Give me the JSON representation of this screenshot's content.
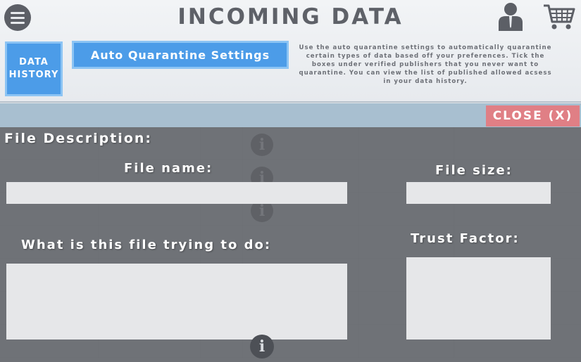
{
  "header": {
    "title": "INCOMING DATA",
    "menu_icon": "hamburger-menu-icon",
    "user_icon": "user-icon",
    "cart_icon": "shopping-cart-icon"
  },
  "toolbar": {
    "history_label": "DATA HISTORY",
    "quarantine_label": "Auto Quarantine Settings",
    "info_text": "Use the auto quarantine settings to automatically quarantine certain types of data based off your preferences. Tick the boxes under verified publishers that you never want to quarantine. You can view the list of published allowed acsess in your data history."
  },
  "modal": {
    "close_label": "CLOSE (X)",
    "description_label": "File Description:",
    "file_name_label": "File name:",
    "file_name_value": "",
    "file_size_label": "File size:",
    "file_size_value": "",
    "purpose_label": "What is this file trying to do:",
    "purpose_value": "",
    "trust_label": "Trust Factor:",
    "trust_value": ""
  },
  "colors": {
    "accent_blue": "#4c9ce8",
    "close_red": "#e07f85",
    "overlay_gray": "#5f6267"
  }
}
